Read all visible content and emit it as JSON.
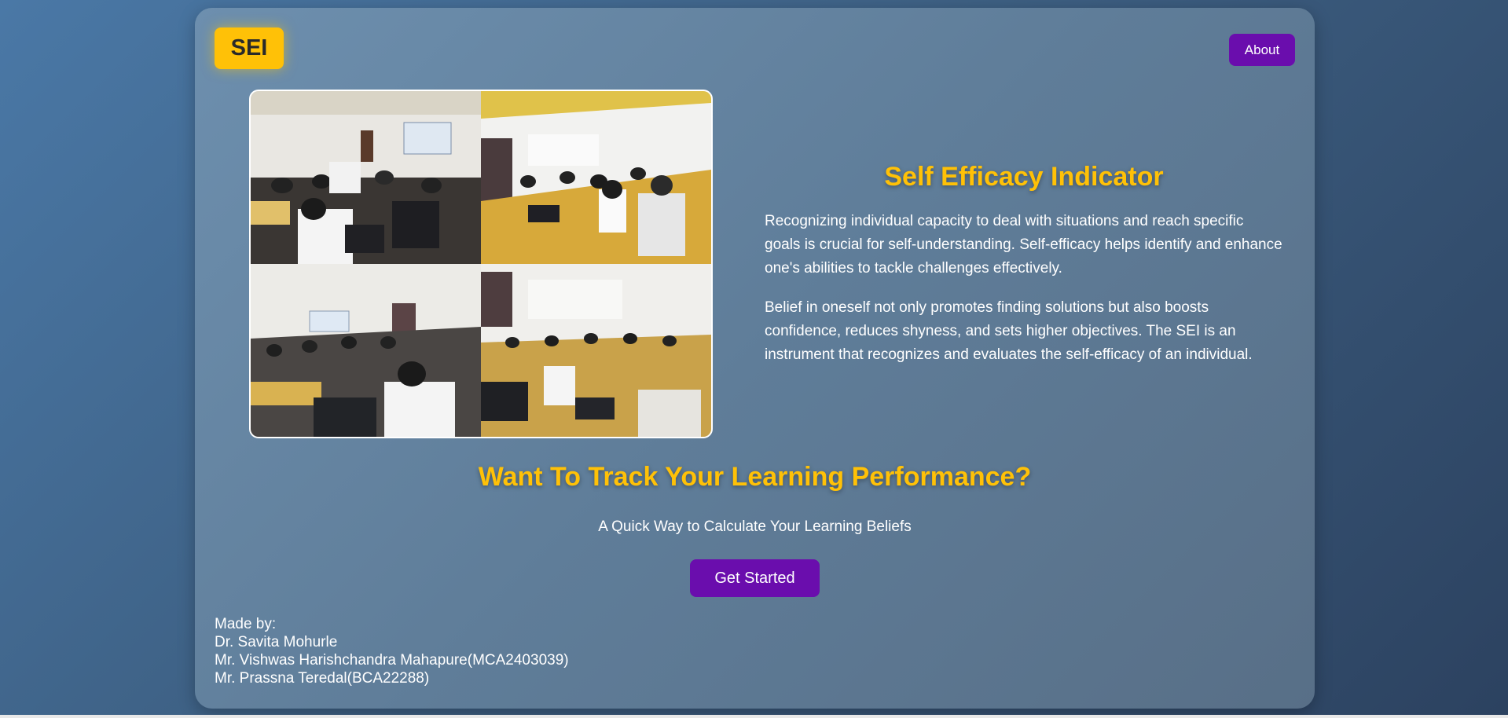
{
  "header": {
    "logo_text": "SEI",
    "about_label": "About"
  },
  "gallery": {
    "photos": [
      {
        "alt": "classroom-photo-1"
      },
      {
        "alt": "classroom-photo-2"
      },
      {
        "alt": "classroom-photo-3"
      },
      {
        "alt": "classroom-photo-4"
      }
    ]
  },
  "info": {
    "title": "Self Efficacy Indicator",
    "paragraph1": "Recognizing individual capacity to deal with situations and reach specific goals is crucial for self-understanding. Self-efficacy helps identify and enhance one's abilities to tackle challenges effectively.",
    "paragraph2": "Belief in oneself not only promotes finding solutions but also boosts confidence, reduces shyness, and sets higher objectives. The SEI is an instrument that recognizes and evaluates the self-efficacy of an individual."
  },
  "cta": {
    "title": "Want To Track Your Learning Performance?",
    "subtitle": "A Quick Way to Calculate Your Learning Beliefs",
    "button_label": "Get Started"
  },
  "credits": {
    "heading": "Made by:",
    "names": [
      "Dr. Savita Mohurle",
      "Mr. Vishwas Harishchandra Mahapure(MCA2403039)",
      "Mr. Prassna Teredal(BCA22288)"
    ]
  },
  "colors": {
    "accent": "#ffc107",
    "button": "#6a0dad",
    "card": "#62809c"
  }
}
